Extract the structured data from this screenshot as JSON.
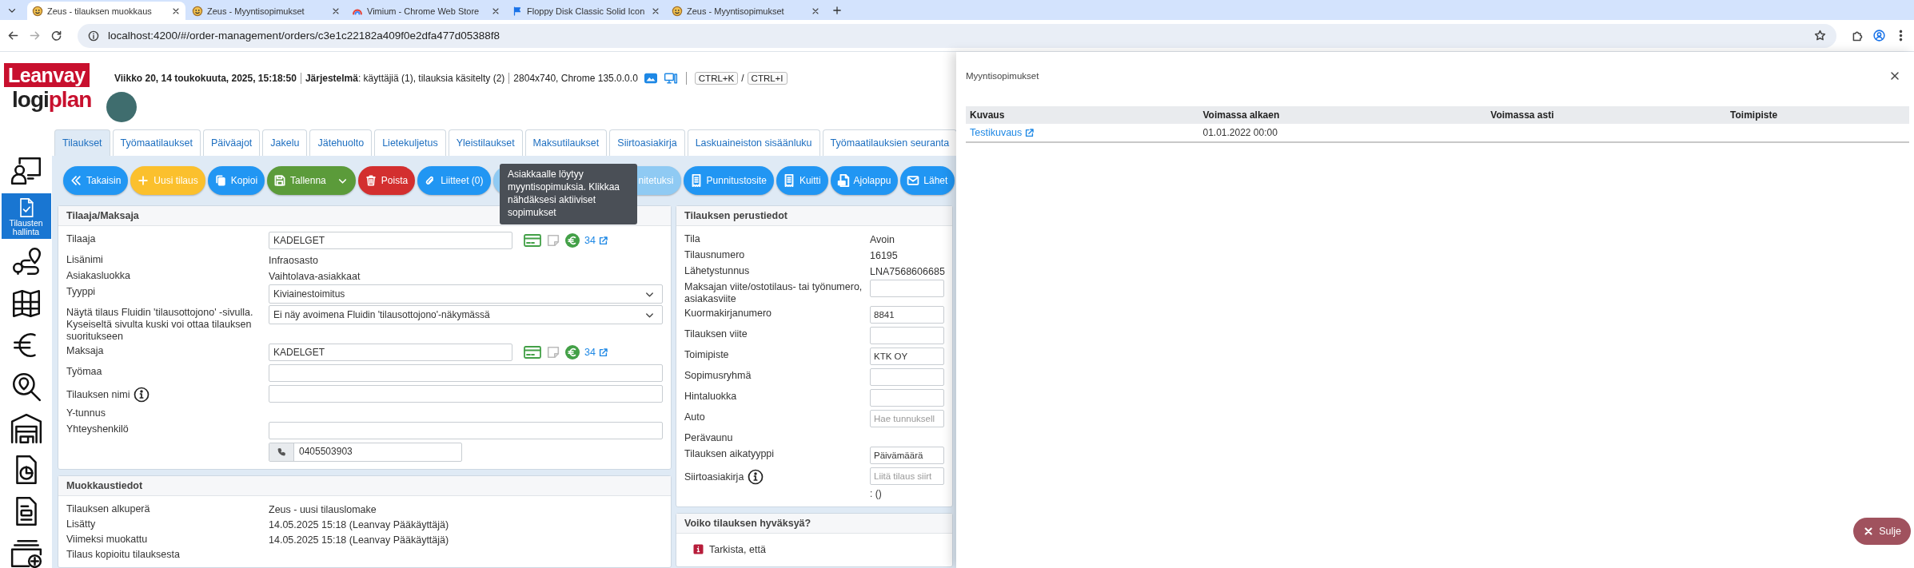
{
  "browser": {
    "tabs": [
      {
        "title": "Zeus - tilauksen muokkaus",
        "kind": "zeus",
        "selected": true
      },
      {
        "title": "Zeus - Myyntisopimukset",
        "kind": "zeus",
        "selected": false
      },
      {
        "title": "Vimium - Chrome Web Store",
        "kind": "store",
        "selected": false
      },
      {
        "title": "Floppy Disk Classic Solid Icon",
        "kind": "flag",
        "selected": false
      },
      {
        "title": "Zeus - Myyntisopimukset",
        "kind": "zeus",
        "selected": false
      }
    ],
    "url": "localhost:4200/#/order-management/orders/c3e1c22182a409f0e2dfa477d05388f8"
  },
  "header": {
    "logo": {
      "top": "Leanvay",
      "bottom_dark": "logi",
      "bottom_red": "plan"
    },
    "date": "Viikko 20, 14 toukokuuta, 2025, 15:18:50",
    "system": "**Järjestelmä**: käyttäjiä (1), tilauksia käsitelty (2)",
    "resolution": "2804x740, Chrome 135.0.0.0",
    "shortcuts": [
      "CTRL+K",
      "CTRL+I"
    ],
    "shortcut_separator": "/"
  },
  "sidebar": [
    {
      "kind": "presentation",
      "selected": false
    },
    {
      "kind": "orders",
      "label": "Tilausten hallinta",
      "selected": true
    },
    {
      "kind": "route",
      "selected": false
    },
    {
      "kind": "map",
      "selected": false
    },
    {
      "kind": "euro",
      "selected": false
    },
    {
      "kind": "search_location",
      "selected": false
    },
    {
      "kind": "garage",
      "selected": false
    },
    {
      "kind": "doc_chart",
      "selected": false
    },
    {
      "kind": "doc",
      "selected": false
    },
    {
      "kind": "folder_plus",
      "selected": false
    }
  ],
  "module_tabs": [
    {
      "label": "Tilaukset",
      "selected": true
    },
    {
      "label": "Työmaatilaukset",
      "selected": false
    },
    {
      "label": "Päiväajot",
      "selected": false
    },
    {
      "label": "Jakelu",
      "selected": false
    },
    {
      "label": "Jätehuolto",
      "selected": false
    },
    {
      "label": "Lietekuljetus",
      "selected": false
    },
    {
      "label": "Yleistilaukset",
      "selected": false
    },
    {
      "label": "Maksutilaukset",
      "selected": false
    },
    {
      "label": "Siirtoasiakirja",
      "selected": false
    },
    {
      "label": "Laskuaineiston sisäänluku",
      "selected": false
    },
    {
      "label": "Työmaatilauksien seuranta",
      "selected": false
    }
  ],
  "toolbar": [
    {
      "label": "Takaisin",
      "kind": "back",
      "color": "#2196f3"
    },
    {
      "label": "Uusi tilaus",
      "kind": "plus",
      "color": "#fbc02d"
    },
    {
      "label": "Kopioi",
      "kind": "copy",
      "color": "#2196f3"
    },
    {
      "label": "Tallenna",
      "kind": "save",
      "color": "#5b9b3a",
      "dropdown": true
    },
    {
      "label": "Poista",
      "kind": "trash",
      "color": "#d32f2f"
    },
    {
      "label": "Liitteet (0)",
      "kind": "clip",
      "color": "#2196f3"
    },
    {
      "label": "nitetuksi",
      "kind": "covered",
      "color": "#8fcaf3"
    },
    {
      "label": "Punnitustosite",
      "kind": "receipt",
      "color": "#2196f3"
    },
    {
      "label": "Kuitti",
      "kind": "receipt",
      "color": "#2196f3"
    },
    {
      "label": "Ajolappu",
      "kind": "pdf",
      "color": "#2196f3"
    },
    {
      "label": "Lähet",
      "kind": "mail",
      "color": "#2196f3"
    }
  ],
  "tooltip": "Asiakkaalle löytyy myyntisopimuksia. Klikkaa nähdäksesi aktiiviset sopimukset",
  "customer_card": {
    "title": "Tilaaja/Maksaja",
    "rows": [
      {
        "label": "Tilaaja",
        "kind": "customer",
        "value": "KADELGET",
        "count": "34"
      },
      {
        "label": "Lisänimi",
        "kind": "text",
        "value": "Infraosasto"
      },
      {
        "label": "Asiakasluokka",
        "kind": "text",
        "value": "Vaihtolava-asiakkaat"
      },
      {
        "label": "Tyyppi",
        "kind": "select",
        "value": "Kiviainestoimitus"
      },
      {
        "label": "Näytä tilaus Fluidin 'tilausottojono' -sivulla. Kyseiseltä sivulta kuski voi ottaa tilauksen suoritukseen",
        "kind": "select",
        "value": "Ei näy avoimena Fluidin 'tilausottojono'-näkymässä"
      },
      {
        "label": "Maksaja",
        "kind": "customer",
        "value": "KADELGET",
        "count": "34"
      },
      {
        "label": "Työmaa",
        "kind": "input"
      },
      {
        "label": "Tilauksen nimi",
        "kind": "input",
        "info": true
      },
      {
        "label": "Y-tunnus",
        "kind": "text"
      },
      {
        "label": "Yhteyshenkilö",
        "kind": "contact",
        "phone": "0405503903"
      }
    ]
  },
  "edit_card": {
    "title": "Muokkaustiedot",
    "rows": [
      {
        "label": "Tilauksen alkuperä",
        "kind": "text",
        "value": "Zeus - uusi tilauslomake"
      },
      {
        "label": "Lisätty",
        "kind": "text",
        "value": "14.05.2025 15:18 (Leanvay Pääkäyttäjä)"
      },
      {
        "label": "Viimeksi muokattu",
        "kind": "text",
        "value": "14.05.2025 15:18 (Leanvay Pääkäyttäjä)"
      },
      {
        "label": "Tilaus kopioitu tilauksesta",
        "kind": "text"
      }
    ]
  },
  "order_card": {
    "title": "Tilauksen perustiedot",
    "rows": [
      {
        "label": "Tila",
        "kind": "text",
        "value": "Avoin"
      },
      {
        "label": "Tilausnumero",
        "kind": "text",
        "value": "16195"
      },
      {
        "label": "Lähetystunnus",
        "kind": "text",
        "value": "LNA7568606685"
      },
      {
        "label": "Maksajan viite/ostotilaus- tai työnumero, asiakasviite",
        "kind": "input"
      },
      {
        "label": "Kuormakirjanumero",
        "kind": "input",
        "value": "8841"
      },
      {
        "label": "Tilauksen viite",
        "kind": "input"
      },
      {
        "label": "Toimipiste",
        "kind": "input",
        "value": "KTK OY"
      },
      {
        "label": "Sopimusryhmä",
        "kind": "input"
      },
      {
        "label": "Hintaluokka",
        "kind": "input"
      },
      {
        "label": "Auto",
        "kind": "input",
        "placeholder": "Hae tunnuksell"
      },
      {
        "label": "Perävaunu",
        "kind": "text"
      },
      {
        "label": "Tilauksen aikatyyppi",
        "kind": "input",
        "value": "Päivämäärä"
      },
      {
        "label": "Siirtoasiakirja",
        "kind": "input",
        "info": true,
        "placeholder": "Liitä tilaus siirt",
        "note": ": ()"
      }
    ]
  },
  "approval_card": {
    "title": "Voiko tilauksen hyväksyä?",
    "items": [
      "Tarkista, että"
    ]
  },
  "panel": {
    "title": "Myyntisopimukset",
    "columns": [
      "Kuvaus",
      "Voimassa alkaen",
      "Voimassa asti",
      "Toimipiste"
    ],
    "rows": [
      {
        "description": "Testikuvaus",
        "valid_from": "01.01.2022 00:00"
      }
    ],
    "close_label": "Sulje"
  }
}
